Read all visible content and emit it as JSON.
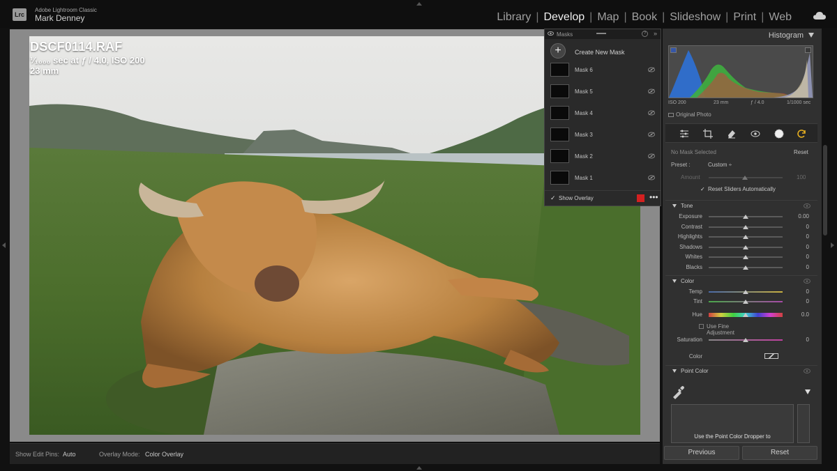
{
  "app": {
    "logo": "Lrc",
    "name": "Adobe Lightroom Classic",
    "user": "Mark Denney"
  },
  "modules": [
    {
      "label": "Library",
      "active": false
    },
    {
      "label": "Develop",
      "active": true
    },
    {
      "label": "Map",
      "active": false
    },
    {
      "label": "Book",
      "active": false
    },
    {
      "label": "Slideshow",
      "active": false
    },
    {
      "label": "Print",
      "active": false
    },
    {
      "label": "Web",
      "active": false
    }
  ],
  "module_separator": "|",
  "image_info": {
    "filename": "DSCF0114.RAF",
    "exposure": "¹⁄₁₀₀₀ sec at ƒ / 4.0, ISO 200",
    "focal_length": "23 mm"
  },
  "toolbar": {
    "edit_pins_label": "Show Edit Pins:",
    "edit_pins_value": "Auto",
    "overlay_mode_label": "Overlay Mode:",
    "overlay_mode_value": "Color Overlay"
  },
  "masks_panel": {
    "title": "Masks",
    "help": "?",
    "collapse": "»",
    "create_label": "Create New Mask",
    "masks": [
      "Mask 6",
      "Mask 5",
      "Mask 4",
      "Mask 3",
      "Mask 2",
      "Mask 1"
    ],
    "show_overlay_label": "Show Overlay",
    "show_overlay_checked": true,
    "overlay_color": "#d42020",
    "more": "•••"
  },
  "histogram": {
    "title": "Histogram",
    "iso": "ISO 200",
    "focal": "23 mm",
    "aperture": "ƒ / 4.0",
    "shutter": "1/1000 sec",
    "original_photo_label": "Original Photo"
  },
  "tools": [
    "sliders-icon",
    "crop-icon",
    "eraser-icon",
    "redeye-icon",
    "mask-icon",
    "refresh-icon"
  ],
  "mask_settings": {
    "no_mask": "No Mask Selected",
    "reset": "Reset",
    "preset_label": "Preset :",
    "preset_value": "Custom ÷",
    "amount_label": "Amount",
    "amount_value": "100",
    "reset_sliders_label": "Reset Sliders Automatically"
  },
  "tone": {
    "title": "Tone",
    "sliders": [
      {
        "label": "Exposure",
        "value": "0.00",
        "level": 0.5
      },
      {
        "label": "Contrast",
        "value": "0",
        "level": 0.5
      },
      {
        "label": "Highlights",
        "value": "0",
        "level": 0.5
      },
      {
        "label": "Shadows",
        "value": "0",
        "level": 0.5
      },
      {
        "label": "Whites",
        "value": "0",
        "level": 0.5
      },
      {
        "label": "Blacks",
        "value": "0",
        "level": 0.5
      }
    ]
  },
  "color": {
    "title": "Color",
    "temp": {
      "label": "Temp",
      "value": "0",
      "level": 0.5
    },
    "tint": {
      "label": "Tint",
      "value": "0",
      "level": 0.5
    },
    "hue": {
      "label": "Hue",
      "value": "0.0",
      "level": 0.5
    },
    "fine_adjust_label": "Use Fine Adjustment",
    "saturation": {
      "label": "Saturation",
      "value": "0",
      "level": 0.5
    },
    "color_label": "Color"
  },
  "point_color": {
    "title": "Point Color",
    "hint": "Use the Point Color Dropper to"
  },
  "buttons": {
    "previous": "Previous",
    "reset": "Reset"
  }
}
